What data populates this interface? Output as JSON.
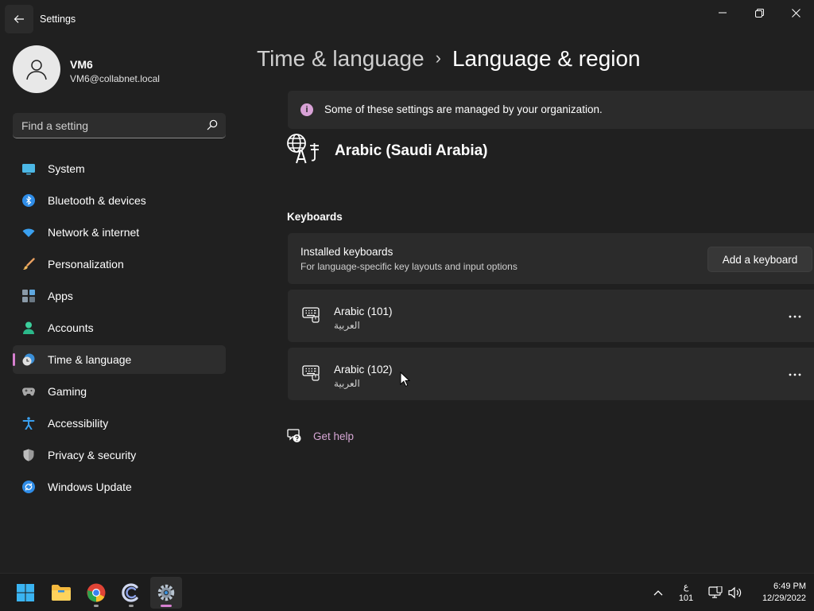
{
  "window": {
    "title": "Settings",
    "controls": [
      "minimize",
      "maximize",
      "close"
    ]
  },
  "user": {
    "name": "VM6",
    "email": "VM6@collabnet.local"
  },
  "search": {
    "placeholder": "Find a setting"
  },
  "nav": {
    "items": [
      {
        "label": "System",
        "icon": "monitor-icon",
        "selected": false
      },
      {
        "label": "Bluetooth & devices",
        "icon": "bluetooth-icon",
        "selected": false
      },
      {
        "label": "Network & internet",
        "icon": "wifi-icon",
        "selected": false
      },
      {
        "label": "Personalization",
        "icon": "brush-icon",
        "selected": false
      },
      {
        "label": "Apps",
        "icon": "apps-icon",
        "selected": false
      },
      {
        "label": "Accounts",
        "icon": "person-icon",
        "selected": false
      },
      {
        "label": "Time & language",
        "icon": "clock-globe-icon",
        "selected": true
      },
      {
        "label": "Gaming",
        "icon": "gamepad-icon",
        "selected": false
      },
      {
        "label": "Accessibility",
        "icon": "accessibility-icon",
        "selected": false
      },
      {
        "label": "Privacy & security",
        "icon": "shield-icon",
        "selected": false
      },
      {
        "label": "Windows Update",
        "icon": "update-icon",
        "selected": false
      }
    ]
  },
  "breadcrumb": {
    "parent": "Time & language",
    "separator": "›",
    "current": "Language & region"
  },
  "banner": {
    "text": "Some of these settings are managed by your organization."
  },
  "language": {
    "name": "Arabic (Saudi Arabia)"
  },
  "keyboards": {
    "section_title": "Keyboards",
    "installed_title": "Installed keyboards",
    "installed_subtitle": "For language-specific key layouts and input options",
    "add_button": "Add a keyboard",
    "items": [
      {
        "name": "Arabic (101)",
        "native": "العربية"
      },
      {
        "name": "Arabic (102)",
        "native": "العربية"
      }
    ]
  },
  "help": {
    "label": "Get help"
  },
  "taskbar": {
    "apps": [
      "start-icon",
      "file-explorer-icon",
      "chrome-icon",
      "collabnet-app-icon",
      "settings-icon"
    ],
    "ime_top": "ع",
    "ime_bottom": "101",
    "time": "6:49 PM",
    "date": "12/29/2022"
  },
  "colors": {
    "accent": "#d680d0",
    "background": "#202020",
    "card": "#2b2b2b"
  }
}
